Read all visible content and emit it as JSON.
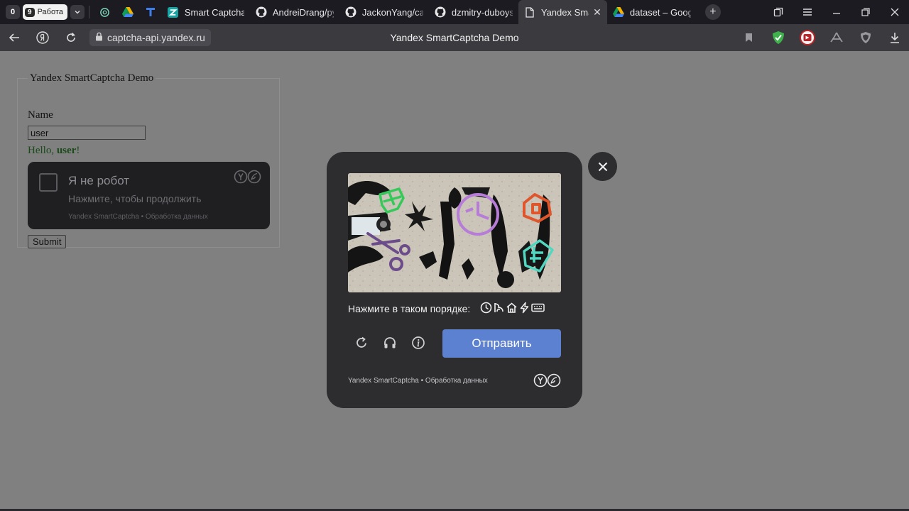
{
  "workspace": {
    "count_badge": "0",
    "work_num": "9",
    "work_label": "Работа"
  },
  "tabs": [
    {
      "title": "Smart Captcha",
      "icon": "zeta-icon"
    },
    {
      "title": "AndreiDrang/py",
      "icon": "github-icon"
    },
    {
      "title": "JackonYang/cap",
      "icon": "github-icon"
    },
    {
      "title": "dzmitry-duboys",
      "icon": "github-icon"
    },
    {
      "title": "Yandex Smar",
      "icon": "page-icon",
      "active": true
    },
    {
      "title": "dataset – Goog",
      "icon": "google-drive-icon"
    }
  ],
  "addressbar": {
    "url": "captcha-api.yandex.ru",
    "page_title": "Yandex SmartCaptcha Demo"
  },
  "form": {
    "legend": "Yandex SmartCaptcha Demo",
    "name_label": "Name",
    "name_value": "user",
    "hello_prefix": "Hello,",
    "hello_user": "user",
    "hello_suffix": "!",
    "submit_label": "Submit"
  },
  "widget": {
    "title": "Я не робот",
    "subtitle": "Нажмите, чтобы продолжить",
    "footer": "Yandex SmartCaptcha • Обработка данных"
  },
  "captcha": {
    "instruction": "Нажмите в таком порядке:",
    "order_icons": [
      "clock-icon",
      "bird-icon",
      "house-icon",
      "lightning-icon",
      "keyboard-icon"
    ],
    "send_label": "Отправить",
    "footer": "Yandex SmartCaptcha • Обработка данных",
    "accent": "#5d81d1",
    "target_colors": {
      "green": "#35c95a",
      "purple": "#b67cd8",
      "orange": "#e0562c",
      "teal": "#52d6bf",
      "violet": "#6b4b8a"
    }
  }
}
